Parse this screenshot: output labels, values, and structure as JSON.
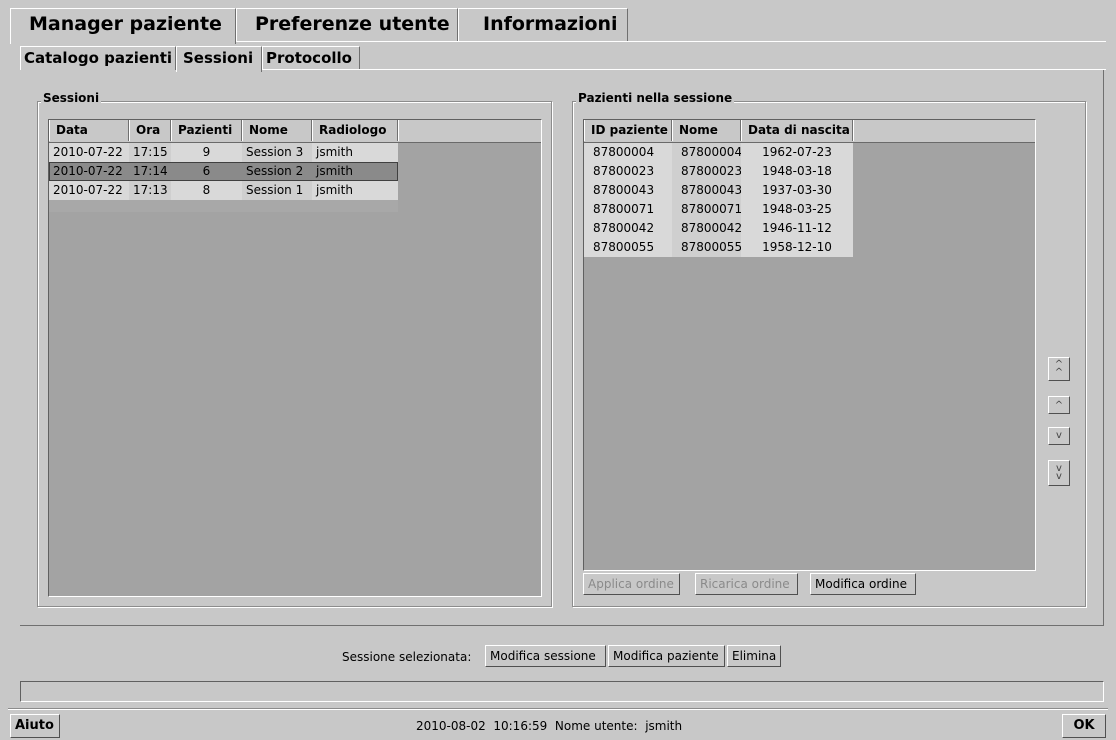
{
  "main_tabs": [
    "Manager paziente",
    "Preferenze utente",
    "Informazioni"
  ],
  "sub_tabs": [
    "Catalogo pazienti",
    "Sessioni",
    "Protocollo"
  ],
  "sessions": {
    "title": "Sessioni",
    "columns": [
      "Data",
      "Ora",
      "Pazienti",
      "Nome",
      "Radiologo"
    ],
    "rows": [
      {
        "data": "2010-07-22",
        "ora": "17:15",
        "pazienti": "9",
        "nome": "Session 3",
        "radiologo": "jsmith"
      },
      {
        "data": "2010-07-22",
        "ora": "17:14",
        "pazienti": "6",
        "nome": "Session 2",
        "radiologo": "jsmith"
      },
      {
        "data": "2010-07-22",
        "ora": "17:13",
        "pazienti": "8",
        "nome": "Session 1",
        "radiologo": "jsmith"
      }
    ]
  },
  "patients": {
    "title": "Pazienti nella sessione",
    "columns": [
      "ID paziente",
      "Nome",
      "Data di nascita"
    ],
    "rows": [
      {
        "id": "87800004",
        "nome": "87800004",
        "dob": "1962-07-23"
      },
      {
        "id": "87800023",
        "nome": "87800023",
        "dob": "1948-03-18"
      },
      {
        "id": "87800043",
        "nome": "87800043",
        "dob": "1937-03-30"
      },
      {
        "id": "87800071",
        "nome": "87800071",
        "dob": "1948-03-25"
      },
      {
        "id": "87800042",
        "nome": "87800042",
        "dob": "1946-11-12"
      },
      {
        "id": "87800055",
        "nome": "87800055",
        "dob": "1958-12-10"
      }
    ],
    "buttons": {
      "apply": "Applica ordine",
      "reload": "Ricarica ordine",
      "edit": "Modifica ordine"
    }
  },
  "arrows": {
    "top": "^\n^",
    "up": "^",
    "down": "v",
    "bottom": "v\nv"
  },
  "selected_session": {
    "label": "Sessione selezionata:",
    "edit_session": "Modifica sessione",
    "edit_patient": "Modifica paziente",
    "delete": "Elimina"
  },
  "footer": {
    "help": "Aiuto",
    "datetime": "2010-08-02  10:16:59",
    "user_label": "Nome utente:",
    "user": "jsmith",
    "ok": "OK"
  }
}
